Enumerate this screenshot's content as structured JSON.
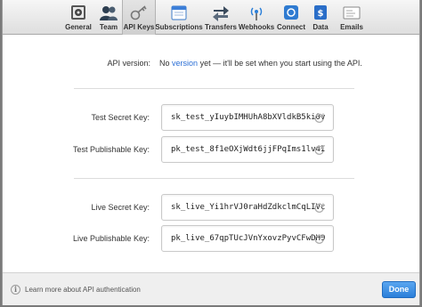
{
  "toolbar": {
    "tabs": [
      {
        "label": "General",
        "icon": "general-icon"
      },
      {
        "label": "Team",
        "icon": "team-icon"
      },
      {
        "label": "API Keys",
        "icon": "key-icon",
        "active": true
      },
      {
        "label": "Subscriptions",
        "icon": "subscriptions-icon"
      },
      {
        "label": "Transfers",
        "icon": "transfers-icon"
      },
      {
        "label": "Webhooks",
        "icon": "webhooks-icon"
      },
      {
        "label": "Connect",
        "icon": "connect-icon"
      },
      {
        "label": "Data",
        "icon": "data-icon"
      },
      {
        "label": "Emails",
        "icon": "emails-icon"
      }
    ]
  },
  "api_version": {
    "label": "API version:",
    "prefix": "No",
    "link": "version",
    "suffix": "yet — it'll be set when you start using the API."
  },
  "keys": {
    "test_secret": {
      "label": "Test Secret Key:",
      "value": "sk_test_yIuybIMHUhA8bXVldkB5ki0v"
    },
    "test_publishable": {
      "label": "Test Publishable Key:",
      "value": "pk_test_8f1eOXjWdt6jjFPqIms1lv4I"
    },
    "live_secret": {
      "label": "Live Secret Key:",
      "value": "sk_live_Yi1hrVJ0raHdZdkclmCqLIVc"
    },
    "live_publishable": {
      "label": "Live Publishable Key:",
      "value": "pk_live_67qpTUcJVnYxovzPyvCFwDH9"
    }
  },
  "footer": {
    "learn_text": "Learn more about API authentication",
    "done_label": "Done"
  },
  "colors": {
    "accent": "#2b7fd9",
    "link": "#2b6fd6"
  }
}
